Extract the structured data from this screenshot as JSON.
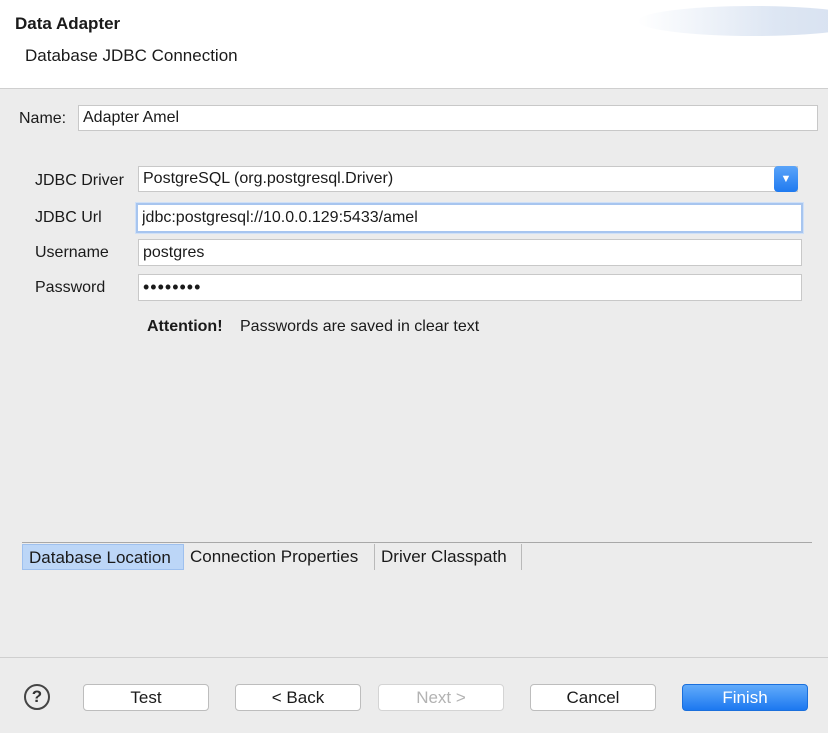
{
  "dialog": {
    "title": "Data Adapter",
    "subtitle": "Database JDBC Connection"
  },
  "name_row": {
    "label": "Name:",
    "value": "Adapter Amel"
  },
  "form": {
    "driver": {
      "label": "JDBC Driver",
      "value": "PostgreSQL (org.postgresql.Driver)"
    },
    "url": {
      "label": "JDBC Url",
      "value": "jdbc:postgresql://10.0.0.129:5433/amel"
    },
    "username": {
      "label": "Username",
      "value": "postgres"
    },
    "password": {
      "label": "Password",
      "value": "••••••••"
    }
  },
  "attention": {
    "label": "Attention!",
    "message": "Passwords are saved in clear text"
  },
  "tabs": [
    {
      "label": "Database Location",
      "active": true
    },
    {
      "label": "Connection Properties",
      "active": false
    },
    {
      "label": "Driver Classpath",
      "active": false
    }
  ],
  "buttons": {
    "help": "?",
    "test": "Test",
    "back": "< Back",
    "next": "Next >",
    "cancel": "Cancel",
    "finish": "Finish"
  },
  "colors": {
    "accent": "#1c78f0",
    "tab_active": "#bcd6f7"
  },
  "icons": {
    "help": "help-icon",
    "dropdown": "chevron-down-icon"
  }
}
